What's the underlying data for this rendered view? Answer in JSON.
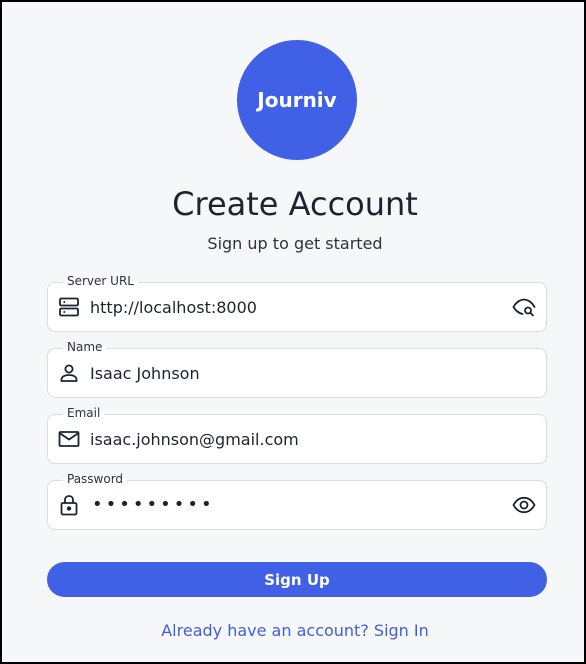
{
  "brand": {
    "logo_text": "Journiv",
    "color": "#4060e6"
  },
  "header": {
    "title": "Create Account",
    "subtitle": "Sign up to get started"
  },
  "form": {
    "server_url": {
      "label": "Server URL",
      "value": "http://localhost:8000",
      "lead_icon": "server-icon",
      "trail_icon": "eye-search-icon"
    },
    "name": {
      "label": "Name",
      "value": "Isaac Johnson",
      "lead_icon": "person-icon"
    },
    "email": {
      "label": "Email",
      "value": "isaac.johnson@gmail.com",
      "lead_icon": "mail-icon"
    },
    "password": {
      "label": "Password",
      "masked_value": "•••••••••",
      "lead_icon": "lock-icon",
      "trail_icon": "eye-icon"
    }
  },
  "actions": {
    "signup_label": "Sign Up",
    "signin_prompt": "Already have an account? Sign In"
  }
}
